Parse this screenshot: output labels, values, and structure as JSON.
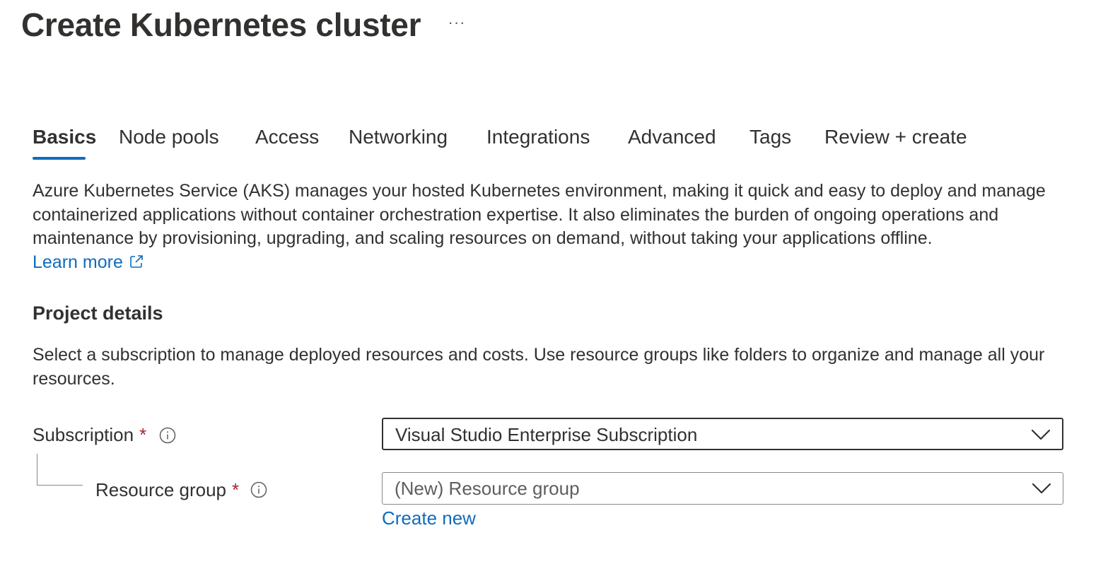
{
  "header": {
    "title": "Create Kubernetes cluster",
    "more_label": "···"
  },
  "tabs": [
    {
      "label": "Basics",
      "active": true
    },
    {
      "label": "Node pools",
      "active": false
    },
    {
      "label": "Access",
      "active": false
    },
    {
      "label": "Networking",
      "active": false
    },
    {
      "label": "Integrations",
      "active": false
    },
    {
      "label": "Advanced",
      "active": false
    },
    {
      "label": "Tags",
      "active": false
    },
    {
      "label": "Review + create",
      "active": false
    }
  ],
  "intro": {
    "description": "Azure Kubernetes Service (AKS) manages your hosted Kubernetes environment, making it quick and easy to deploy and manage containerized applications without container orchestration expertise. It also eliminates the burden of ongoing operations and maintenance by provisioning, upgrading, and scaling resources on demand, without taking your applications offline.",
    "learn_more": "Learn more"
  },
  "project_details": {
    "heading": "Project details",
    "description": "Select a subscription to manage deployed resources and costs. Use resource groups like folders to organize and manage all your resources.",
    "subscription": {
      "label": "Subscription",
      "required_mark": "*",
      "value": "Visual Studio Enterprise Subscription"
    },
    "resource_group": {
      "label": "Resource group",
      "required_mark": "*",
      "value": "(New) Resource group",
      "create_new": "Create new"
    }
  },
  "colors": {
    "accent": "#0f6cbd",
    "required": "#a4262c",
    "text": "#323130"
  },
  "icons": {
    "more": "ellipsis-icon",
    "external": "external-link-icon",
    "info": "info-icon",
    "dropdown": "chevron-down-icon"
  }
}
